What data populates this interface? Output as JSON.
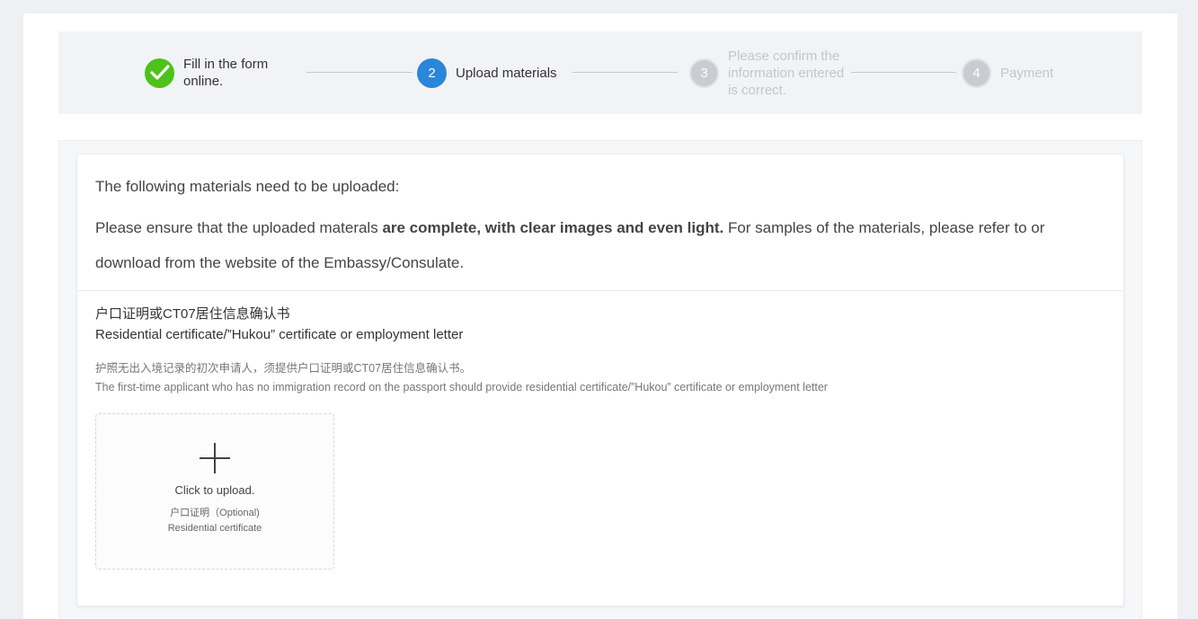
{
  "stepper": {
    "steps": [
      {
        "number": "",
        "label": "Fill in the form online.",
        "state": "done"
      },
      {
        "number": "2",
        "label": "Upload materials",
        "state": "active"
      },
      {
        "number": "3",
        "label": "Please confirm the information entered is correct.",
        "state": "pending"
      },
      {
        "number": "4",
        "label": "Payment",
        "state": "pending"
      }
    ]
  },
  "intro": {
    "line1": "The following materials need to be uploaded:",
    "line2_prefix": "Please ensure that the uploaded materals ",
    "line2_bold": "are complete, with clear images and even light.",
    "line2_suffix": " For samples of the materials, please refer to or download from the website of the Embassy/Consulate."
  },
  "section": {
    "title_cn": "户口证明或CT07居住信息确认书",
    "title_en": "Residential certificate/”Hukou” certificate or employment letter",
    "note_cn": "护照无出入境记录的初次申请人，须提供户口证明或CT07居住信息确认书。",
    "note_en": "The first-time applicant who has no immigration record on the passport should provide residential certificate/”Hukou” certificate or employment letter"
  },
  "upload": {
    "label": "Click to upload.",
    "sub_cn": "户口证明（Optional)",
    "sub_en": "Residential certificate"
  },
  "colors": {
    "done": "#4cc21a",
    "active": "#2a86d8",
    "pending": "#c9ccd2"
  }
}
